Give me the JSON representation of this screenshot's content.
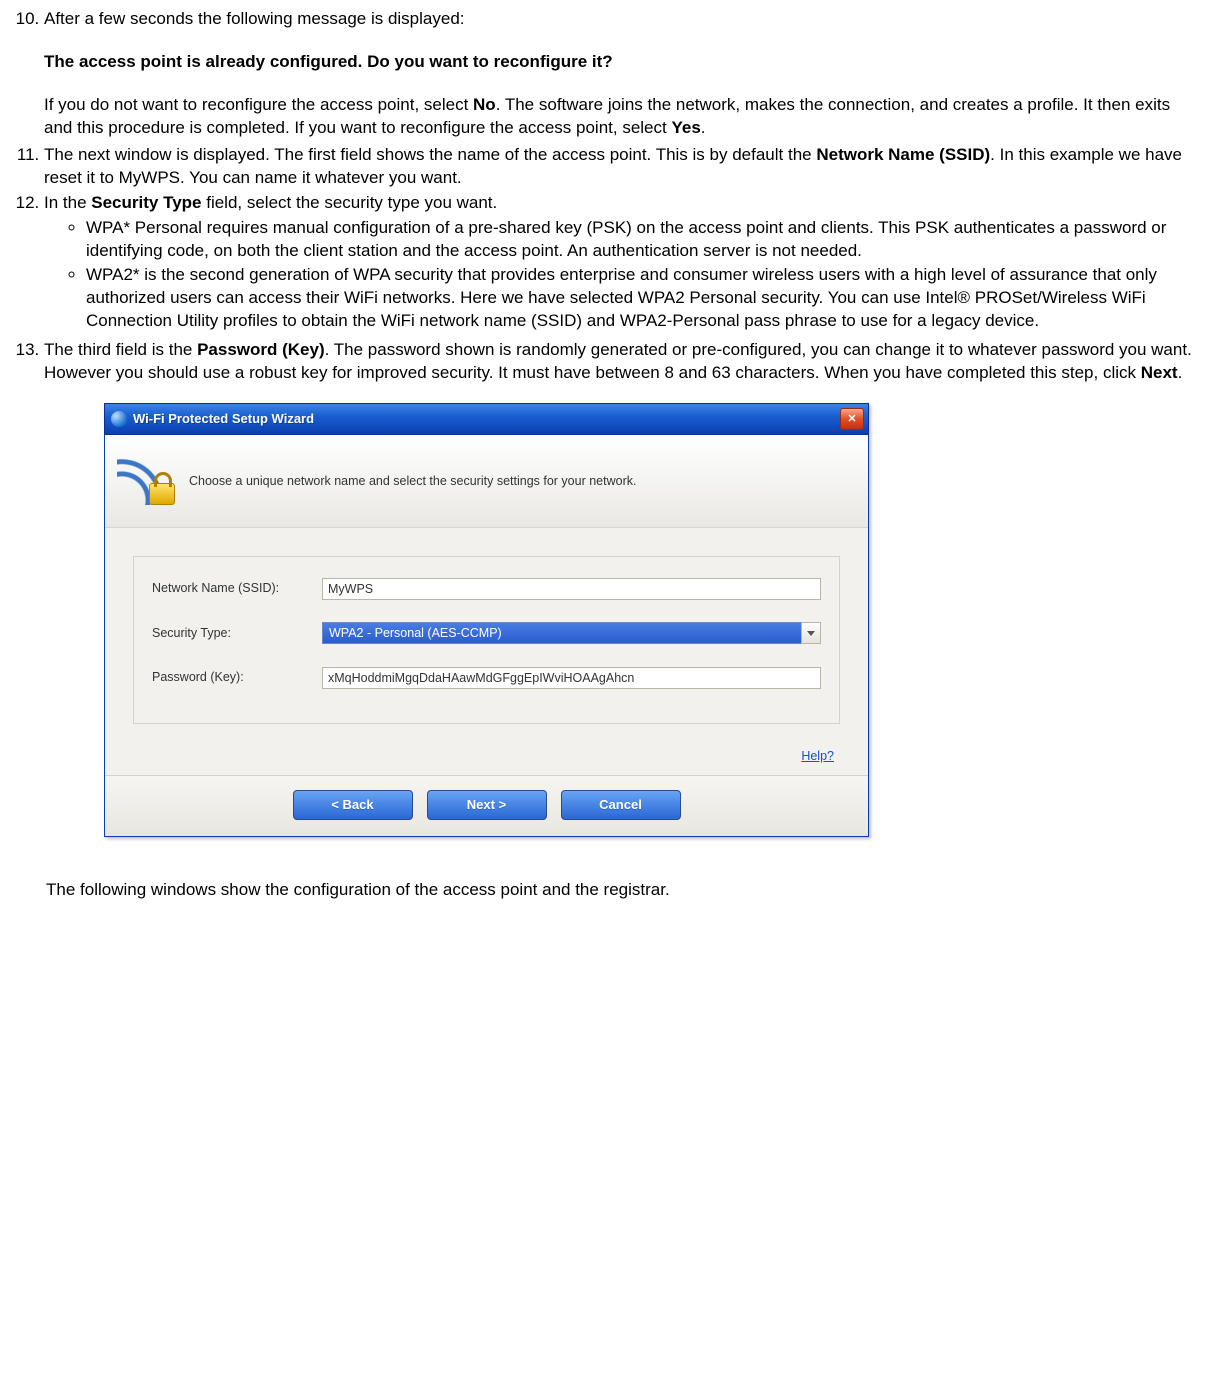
{
  "list": {
    "start": 10,
    "item10": {
      "p1": "After a few seconds the following message is displayed:",
      "p2": "The access point is already configured. Do you want to reconfigure it?",
      "p3a": "If you do not want to reconfigure the access point, select ",
      "p3b": "No",
      "p3c": ". The software joins the network, makes the connection, and creates a profile. It then exits and this procedure is completed. If you want to reconfigure the access point, select ",
      "p3d": "Yes",
      "p3e": "."
    },
    "item11": {
      "a": "The next window is displayed. The first field shows the name of the access point. This is by default the ",
      "b": "Network Name (SSID)",
      "c": ". In this example we have reset it to MyWPS. You can name it whatever you want."
    },
    "item12": {
      "a": "In the ",
      "b": "Security Type",
      "c": " field, select the security type you want.",
      "sub1": "WPA* Personal requires manual configuration of a pre-shared key (PSK) on the access point and clients. This PSK authenticates a password or identifying code, on both the client station and the access point. An authentication server is not needed.",
      "sub2": "WPA2* is the second generation of WPA security that provides enterprise and consumer wireless users with a high level of assurance that only authorized users can access their WiFi networks. Here we have selected WPA2 Personal security. You can use Intel® PROSet/Wireless WiFi Connection Utility profiles to obtain the WiFi network name (SSID) and WPA2-Personal pass phrase to use for a legacy device."
    },
    "item13": {
      "a": "The third field is the ",
      "b": "Password (Key)",
      "c": ". The password shown is randomly generated or pre-configured, you can change it to whatever password you want. However you should use a robust key for improved security. It must have between 8 and 63 characters. When you have completed this step, click ",
      "d": "Next",
      "e": "."
    }
  },
  "window": {
    "title": "Wi-Fi Protected Setup Wizard",
    "close_glyph": "✕",
    "banner_text": "Choose a unique network name and select the security settings for your network.",
    "labels": {
      "ssid": "Network Name (SSID):",
      "security": "Security Type:",
      "password": "Password (Key):"
    },
    "values": {
      "ssid": "MyWPS",
      "security": "WPA2 - Personal (AES-CCMP)",
      "password": "xMqHoddmiMgqDdaHAawMdGFggEpIWviHOAAgAhcn"
    },
    "help": "Help?",
    "buttons": {
      "back": "<  Back",
      "next": "Next  >",
      "cancel": "Cancel"
    }
  },
  "footer": "The following windows show the configuration of the access point and the registrar."
}
